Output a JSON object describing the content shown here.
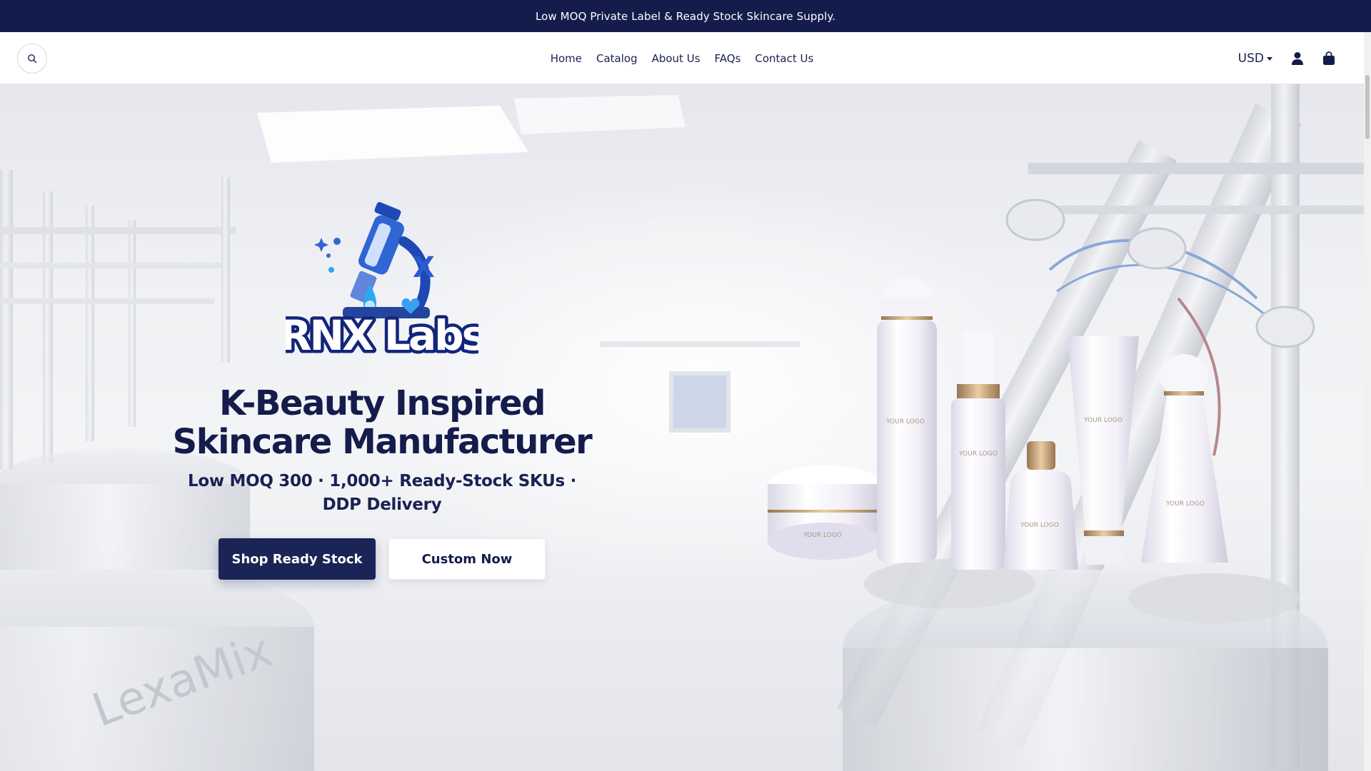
{
  "announcement": {
    "text": "Low MOQ Private Label & Ready Stock Skincare Supply."
  },
  "header": {
    "nav": [
      {
        "label": "Home"
      },
      {
        "label": "Catalog"
      },
      {
        "label": "About Us"
      },
      {
        "label": "FAQs"
      },
      {
        "label": "Contact Us"
      }
    ],
    "currency": "USD"
  },
  "hero": {
    "logo_text": "RNX Labs",
    "title_line1": "K-Beauty Inspired",
    "title_line2": "Skincare Manufacturer",
    "subtitle": "Low MOQ 300 · 1,000+ Ready-Stock SKUs · DDP Delivery",
    "primary_cta": "Shop Ready Stock",
    "secondary_cta": "Custom Now",
    "product_label": "YOUR LOGO",
    "equipment_text": "LexaMix"
  },
  "icons": [
    "search-icon",
    "account-icon",
    "cart-icon",
    "chevron-down-icon"
  ],
  "colors": {
    "brand_navy": "#141c4c",
    "button_navy": "#1a2457",
    "page_bg": "#ffffff",
    "accent_gold": "#b89262"
  }
}
